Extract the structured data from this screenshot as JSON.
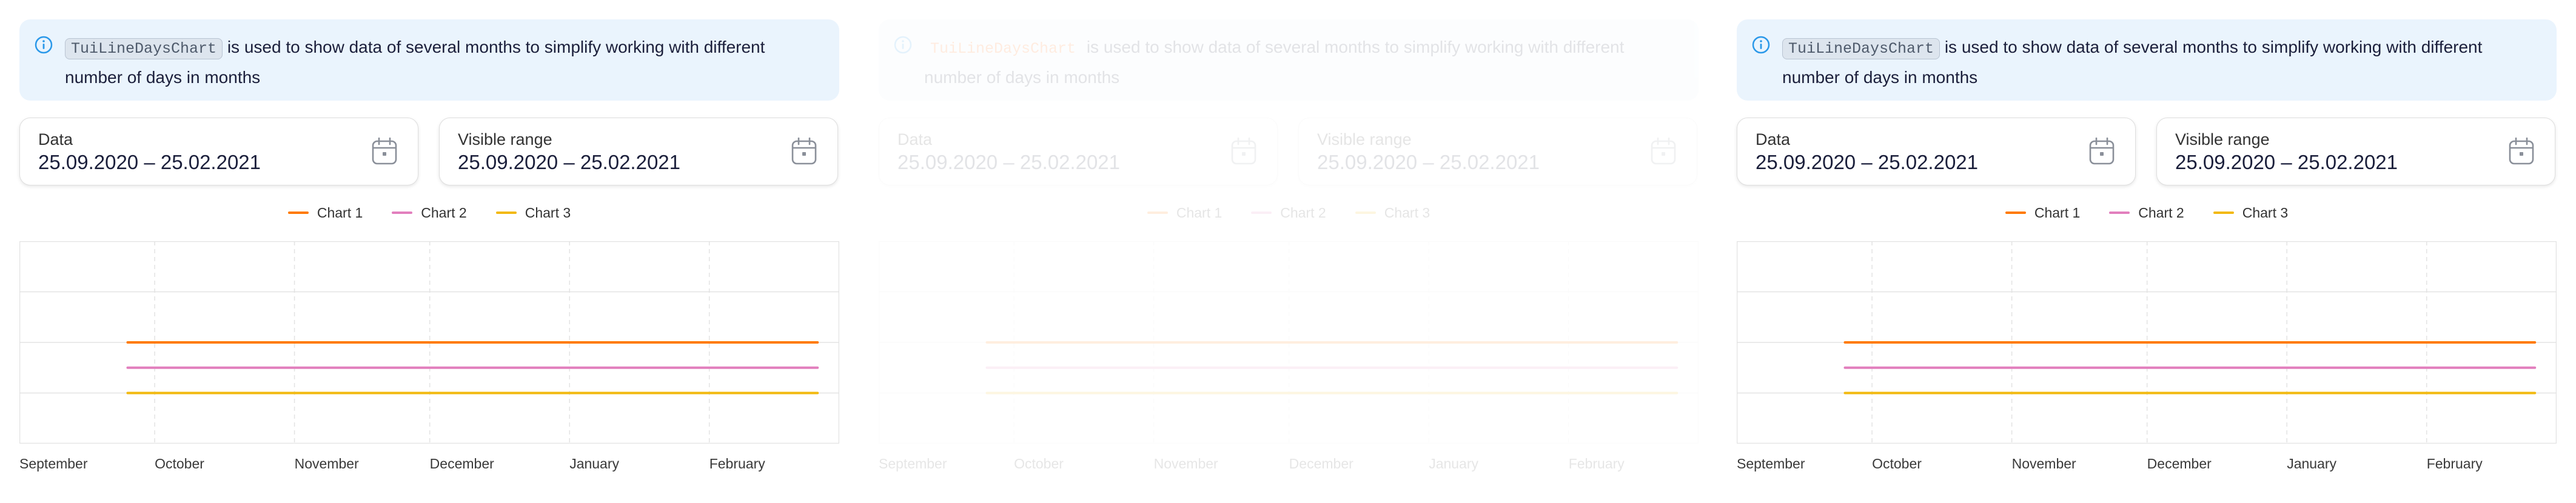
{
  "notice": {
    "code": "TuiLineDaysChart",
    "text": " is used to show data of several months to simplify working with different number of days in months",
    "icon": "info-icon"
  },
  "fields": {
    "data_label": "Data",
    "data_value": "25.09.2020 – 25.02.2021",
    "range_label": "Visible range",
    "range_value": "25.09.2020 – 25.02.2021",
    "icon": "calendar-icon"
  },
  "colors": {
    "notice_bg": "#eaf4fd",
    "info_accent": "#2a98e9",
    "chart1": "#ff7a00",
    "chart2": "#e27fbd",
    "chart3": "#f2b90f",
    "grid": "#e3e3e3"
  },
  "chart_data": {
    "type": "line",
    "x_tick_labels": [
      "September",
      "October",
      "November",
      "December",
      "January",
      "February"
    ],
    "x_range": [
      "2020-09-01",
      "2021-02-28"
    ],
    "series": [
      {
        "name": "Chart 1",
        "color": "#ff7a00",
        "x": [
          "2020-09-25",
          "2021-02-25"
        ],
        "y": [
          50,
          50
        ]
      },
      {
        "name": "Chart 2",
        "color": "#e27fbd",
        "x": [
          "2020-09-25",
          "2021-02-25"
        ],
        "y": [
          37.5,
          37.5
        ]
      },
      {
        "name": "Chart 3",
        "color": "#f2b90f",
        "x": [
          "2020-09-25",
          "2021-02-25"
        ],
        "y": [
          25,
          25
        ]
      }
    ],
    "ylim": [
      0,
      100
    ],
    "grid": true,
    "legend": "top-center"
  }
}
